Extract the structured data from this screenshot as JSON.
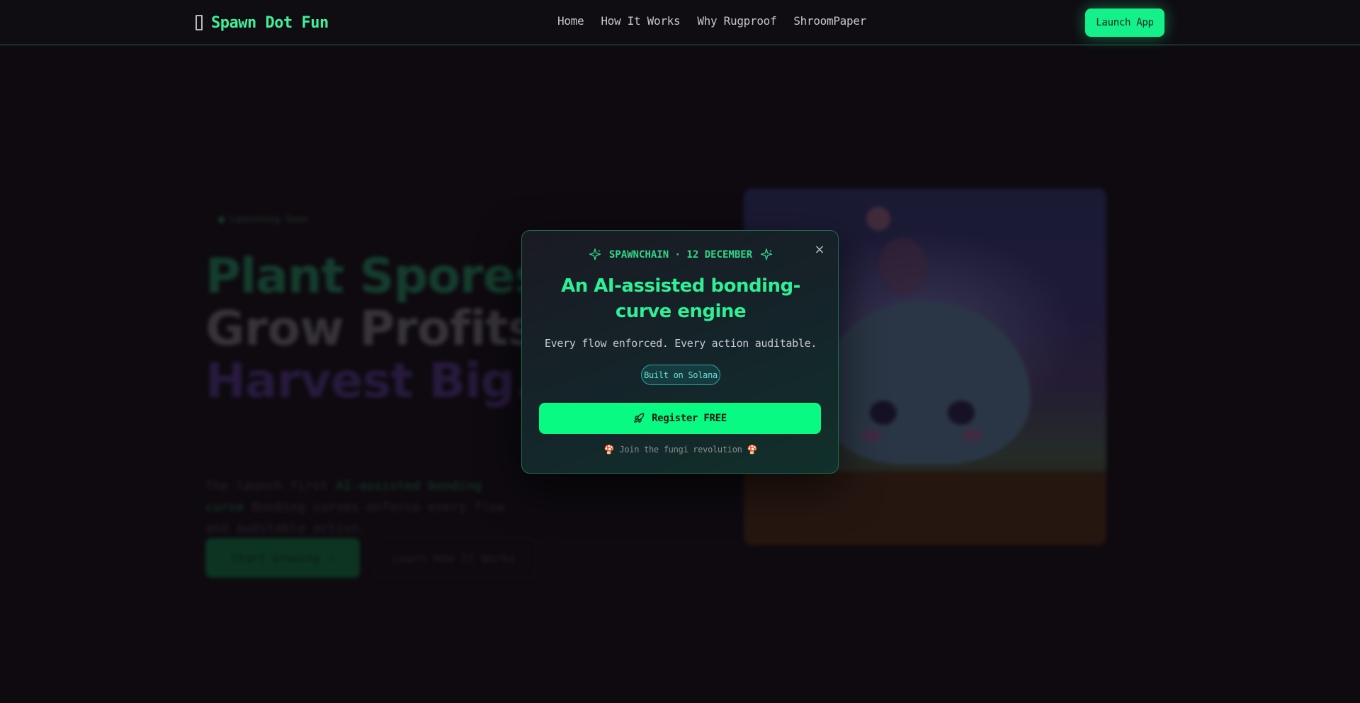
{
  "navbar": {
    "brand_name": "Spawn Dot Fun",
    "links": [
      "Home",
      "How It Works",
      "Why Rugproof",
      "ShroomPaper"
    ],
    "launch_label": "Launch App"
  },
  "hero": {
    "badge": "Launching Soon",
    "title_line1": "Plant Spores.",
    "title_line2": "Grow Profits.",
    "title_line3": "Harvest Big.",
    "desc_prefix": "The launch first ",
    "desc_highlight": "AI-assisted bonding curve",
    "desc_suffix": " Bonding curves enforce every flow and auditable action.",
    "primary_button": "Start Growing →",
    "secondary_button": "Learn How It Works"
  },
  "modal": {
    "eyebrow": "SPAWNCHAIN · 12 DECEMBER",
    "title": "An AI-assisted bonding-curve engine",
    "subtitle": "Every flow enforced. Every action auditable.",
    "pill": "Built on Solana",
    "cta": "Register FREE",
    "footer": "🍄 Join the fungi revolution 🍄",
    "close": "×"
  },
  "colors": {
    "accent": "#08fa82",
    "accent_text": "#2ef095",
    "background": "#120d14",
    "modal_border": "#1f6d52"
  },
  "icons": [
    "mushroom-icon",
    "sparkle-icon",
    "close-icon",
    "rocket-icon"
  ]
}
